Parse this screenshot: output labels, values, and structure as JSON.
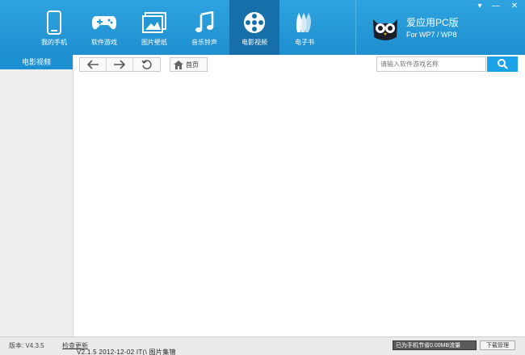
{
  "nav": {
    "items": [
      {
        "label": "我的手机",
        "icon": "phone-icon",
        "active": false
      },
      {
        "label": "软件游戏",
        "icon": "gamepad-icon",
        "active": false
      },
      {
        "label": "图片壁纸",
        "icon": "image-icon",
        "active": false
      },
      {
        "label": "音乐铃声",
        "icon": "music-note-icon",
        "active": false
      },
      {
        "label": "电影视频",
        "icon": "film-reel-icon",
        "active": true
      },
      {
        "label": "电子书",
        "icon": "book-icon",
        "active": false
      }
    ]
  },
  "brand": {
    "title": "爱应用PC版",
    "subtitle": "For WP7 / WP8",
    "logo": "owl-logo"
  },
  "window_controls": {
    "menu": "▾",
    "minimize": "—",
    "close": "✕"
  },
  "sidebar": {
    "items": [
      {
        "label": "电影视频",
        "active": true
      }
    ]
  },
  "toolbar": {
    "back_icon": "arrow-left-icon",
    "forward_icon": "arrow-right-icon",
    "refresh_icon": "refresh-icon",
    "home_label": "首页",
    "search_placeholder": "请输入软件游戏名称"
  },
  "statusbar": {
    "version": "版本: V4.3.5",
    "check_update": "检查更新",
    "traffic": "已为手机节省0.00MB流量",
    "download_manager": "下载管理",
    "behind_text": "V2.1.5  2012-12-02    IT(\\  图片集锦"
  },
  "colors": {
    "header": "#239ad7",
    "active_tab": "#166fa8",
    "sidebar_active": "#1d90d1",
    "search_button": "#1aa3e8"
  }
}
